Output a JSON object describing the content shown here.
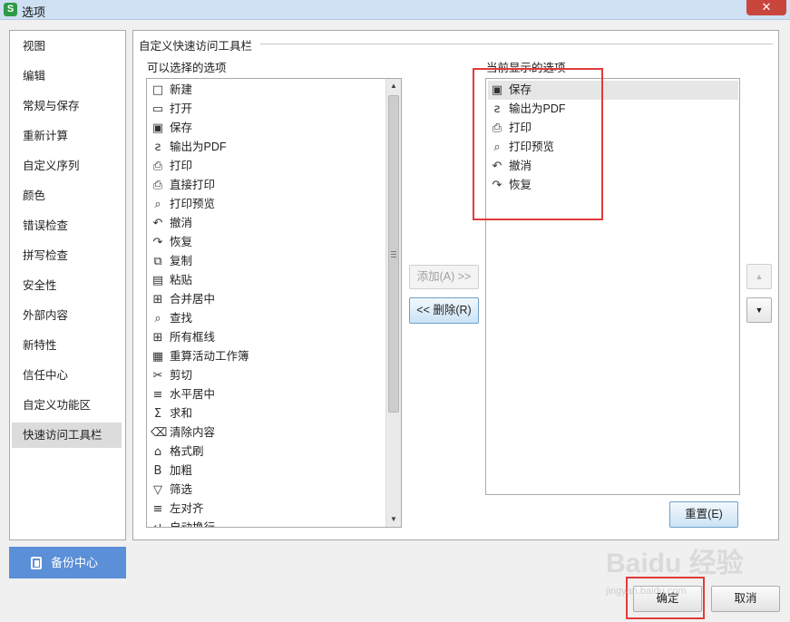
{
  "window": {
    "title": "选项",
    "app_icon": "S",
    "close_icon": "close-icon"
  },
  "nav": {
    "items": [
      {
        "label": "视图"
      },
      {
        "label": "编辑"
      },
      {
        "label": "常规与保存"
      },
      {
        "label": "重新计算"
      },
      {
        "label": "自定义序列"
      },
      {
        "label": "颜色"
      },
      {
        "label": "错误检查"
      },
      {
        "label": "拼写检查"
      },
      {
        "label": "安全性"
      },
      {
        "label": "外部内容"
      },
      {
        "label": "新特性"
      },
      {
        "label": "信任中心"
      },
      {
        "label": "自定义功能区"
      },
      {
        "label": "快速访问工具栏"
      }
    ],
    "selected": "快速访问工具栏"
  },
  "backup": {
    "label": "备份中心",
    "icon": "backup-icon"
  },
  "panel": {
    "group_title": "自定义快速访问工具栏",
    "available_label": "可以选择的选项",
    "current_label": "当前显示的选项",
    "available": [
      {
        "label": "新建",
        "icon": "□"
      },
      {
        "label": "打开",
        "icon": "▭"
      },
      {
        "label": "保存",
        "icon": "▣"
      },
      {
        "label": "输出为PDF",
        "icon": "ƨ"
      },
      {
        "label": "打印",
        "icon": "⎙"
      },
      {
        "label": "直接打印",
        "icon": "⎙"
      },
      {
        "label": "打印预览",
        "icon": "⌕"
      },
      {
        "label": "撤消",
        "icon": "↶"
      },
      {
        "label": "恢复",
        "icon": "↷"
      },
      {
        "label": "复制",
        "icon": "⧉"
      },
      {
        "label": "粘贴",
        "icon": "▤"
      },
      {
        "label": "合并居中",
        "icon": "⊞"
      },
      {
        "label": "查找",
        "icon": "⌕"
      },
      {
        "label": "所有框线",
        "icon": "⊞"
      },
      {
        "label": "重算活动工作簿",
        "icon": "▦"
      },
      {
        "label": "剪切",
        "icon": "✂"
      },
      {
        "label": "水平居中",
        "icon": "≡"
      },
      {
        "label": "求和",
        "icon": "Σ"
      },
      {
        "label": "清除内容",
        "icon": "⌫"
      },
      {
        "label": "格式刷",
        "icon": "⌂"
      },
      {
        "label": "加粗",
        "icon": "B"
      },
      {
        "label": "筛选",
        "icon": "▽"
      },
      {
        "label": "左对齐",
        "icon": "≡"
      },
      {
        "label": "自动换行",
        "icon": "↵"
      }
    ],
    "current": [
      {
        "label": "保存",
        "icon": "▣"
      },
      {
        "label": "输出为PDF",
        "icon": "ƨ"
      },
      {
        "label": "打印",
        "icon": "⎙"
      },
      {
        "label": "打印预览",
        "icon": "⌕"
      },
      {
        "label": "撤消",
        "icon": "↶"
      },
      {
        "label": "恢复",
        "icon": "↷"
      }
    ],
    "current_selected": "保存",
    "add_button": "添加(A) >>",
    "remove_button": "<< 删除(R)",
    "reset_button": "重置(E)",
    "up_icon": "▲",
    "down_icon": "▼"
  },
  "footer": {
    "ok": "确定",
    "cancel": "取消"
  },
  "watermark": {
    "text": "Baidu 经验",
    "sub": "jingyan.baidu.com"
  },
  "colors": {
    "accent": "#5b8fd8",
    "highlight": "#e23b3b",
    "titlebar": "#cfe0f2"
  }
}
